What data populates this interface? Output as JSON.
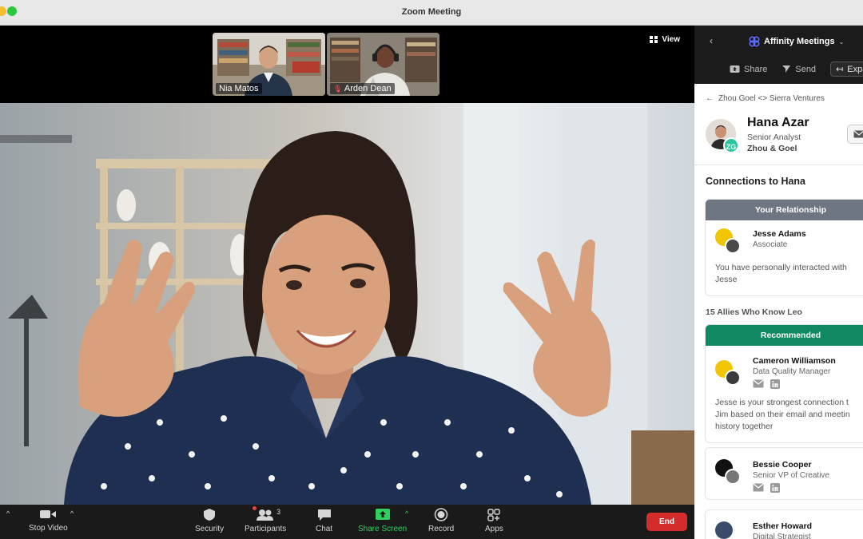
{
  "window": {
    "title": "Zoom Meeting"
  },
  "thumbnails": [
    {
      "name": "Nia Matos"
    },
    {
      "name": "Arden Dean"
    }
  ],
  "view_button": {
    "label": "View"
  },
  "toolbar": {
    "stop_video": "Stop Video",
    "security": "Security",
    "participants": "Participants",
    "participants_count": "3",
    "chat": "Chat",
    "share_screen": "Share Screen",
    "record": "Record",
    "apps": "Apps",
    "end": "End"
  },
  "side_panel": {
    "app_name": "Affinity Meetings",
    "actions": {
      "share": "Share",
      "send": "Send",
      "expand": "Expar"
    },
    "breadcrumb": "Zhou Goel <> Sierra Ventures",
    "profile": {
      "name": "Hana Azar",
      "title": "Senior Analyst",
      "company": "Zhou & Goel",
      "badge": "ZG"
    },
    "connections_title": "Connections to Hana",
    "your_relationship": {
      "header": "Your Relationship",
      "person": {
        "name": "Jesse Adams",
        "role": "Associate"
      },
      "note_lines": [
        "You have personally interacted with",
        "Jesse"
      ]
    },
    "allies_title": "15 Allies Who Know Leo",
    "recommended": {
      "header": "Recommended",
      "person": {
        "name": "Cameron Williamson",
        "role": "Data Quality Manager"
      },
      "note_lines": [
        "Jesse is your strongest connection t",
        "Jim based on their email and meetin",
        "history together"
      ]
    },
    "others": [
      {
        "name": "Bessie Cooper",
        "role": "Senior VP of Creative"
      },
      {
        "name": "Esther Howard",
        "role": "Digital Strategist"
      }
    ]
  },
  "colors": {
    "accent_green": "#108862",
    "end_red": "#d42b2b",
    "share_green": "#2fd05d",
    "badge_teal": "#2cc6a3"
  }
}
